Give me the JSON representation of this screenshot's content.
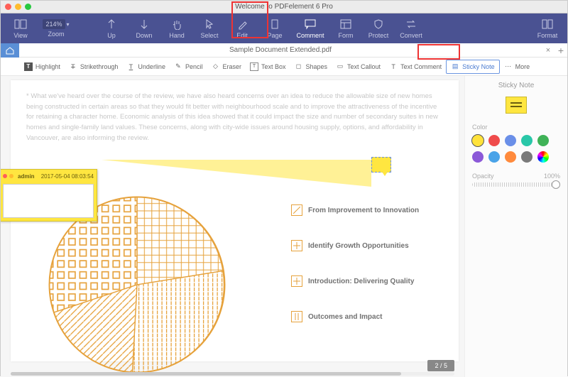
{
  "app_title": "Welcome to PDFelement 6 Pro",
  "toolbar": {
    "view": "View",
    "zoom": "Zoom",
    "zoom_value": "214%",
    "up": "Up",
    "down": "Down",
    "hand": "Hand",
    "select": "Select",
    "edit": "Edit",
    "page": "Page",
    "comment": "Comment",
    "form": "Form",
    "protect": "Protect",
    "convert": "Convert",
    "format": "Format"
  },
  "doc_tab": "Sample Document Extended.pdf",
  "subtoolbar": {
    "highlight": "Highlight",
    "strikethrough": "Strikethrough",
    "underline": "Underline",
    "pencil": "Pencil",
    "eraser": "Eraser",
    "textbox": "Text Box",
    "shapes": "Shapes",
    "textcallout": "Text Callout",
    "textcomment": "Text Comment",
    "stickynote": "Sticky Note",
    "more": "More"
  },
  "body_para": "* What we've heard over the course of the review, we have also heard concerns over an idea to reduce the allowable size of new homes being constructed in certain areas so that they would fit better with neighbourhood scale and to improve the attractiveness of the incentive for retaining a character home. Economic analysis of this idea showed that it could impact the size and number of secondary suites in new homes and single-family land values. These concerns, along with city-wide issues around housing supply, options, and affordability in Vancouver, are also informing the review.",
  "popup": {
    "author": "admin",
    "date": "2017-05-04 08:03:54"
  },
  "legend": {
    "a": "From Improvement to Innovation",
    "b": "Identify Growth Opportunities",
    "c": "Introduction: Delivering Quality",
    "d": "Outcomes and Impact"
  },
  "page_indicator": "2 / 5",
  "side": {
    "title": "Sticky Note",
    "color_label": "Color",
    "opacity_label": "Opacity",
    "opacity_value": "100%",
    "colors": [
      "#ffe23a",
      "#ef4b4b",
      "#6a8fe8",
      "#29c7a8",
      "#3fb257",
      "#8b59d8",
      "#4aa3e8",
      "#ff8a3c",
      "#7a7a7a"
    ]
  }
}
